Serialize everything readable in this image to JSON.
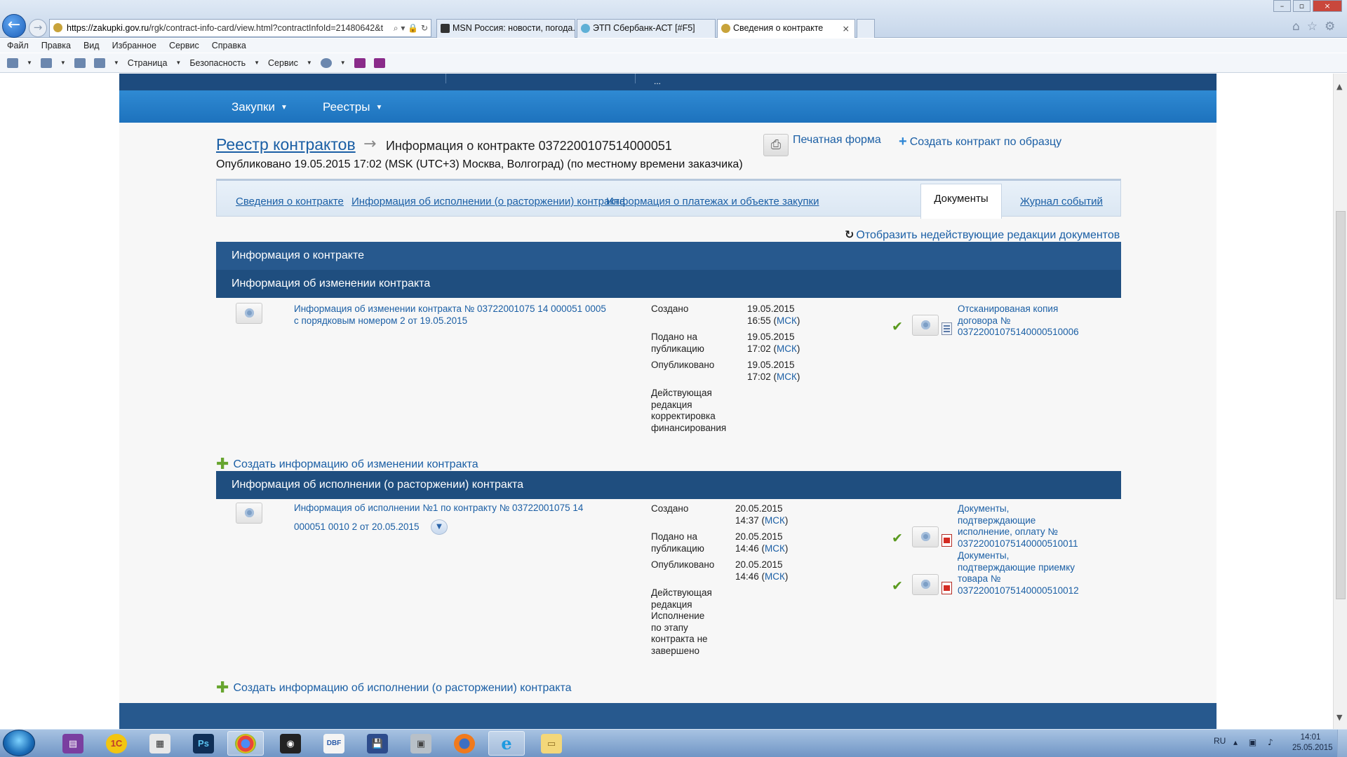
{
  "browser": {
    "url_site": "https://zakupki.gov.ru",
    "url_rest": "/rgk/contract-info-card/view.html?contractInfoId=21480642&t",
    "tabs": [
      {
        "label": "MSN Россия: новости, погода..."
      },
      {
        "label": "ЭТП Сбербанк-АСТ [#F5]"
      },
      {
        "label": "Сведения о контракте",
        "active": true
      }
    ],
    "menu": [
      "Файл",
      "Правка",
      "Вид",
      "Избранное",
      "Сервис",
      "Справка"
    ],
    "commands": {
      "page": "Страница",
      "security": "Безопасность",
      "service": "Сервис"
    }
  },
  "site": {
    "topnav_more": "...",
    "nav": [
      "Закупки",
      "Реестры"
    ],
    "breadcrumb": {
      "root": "Реестр контрактов",
      "current": "Информация о контракте 0372200107514000051"
    },
    "print_form": "Печатная форма",
    "create_by_sample": "Создать контракт по образцу",
    "published": "Опубликовано 19.05.2015 17:02 (MSK (UTC+3) Москва, Волгоград) (по местному времени заказчика)",
    "tabs": [
      "Сведения о контракте",
      "Информация об исполнении (о расторжении) контракта",
      "Информация о платежах и объекте закупки",
      "Документы",
      "Журнал событий"
    ],
    "active_tab": "Документы",
    "show_inactive": "Отобразить недействующие редакции документов"
  },
  "sections": {
    "contract_info": "Информация о контракте",
    "change_info": {
      "title": "Информация об изменении контракта",
      "doc_title_1": "Информация об изменении контракта № 03722001075 14 000051 0005",
      "doc_title_2": "с порядковым номером 2 от 19.05.2015",
      "created_label": "Создано",
      "created_date": "19.05.2015",
      "created_time": "16:55",
      "submitted_label_1": "Подано на",
      "submitted_label_2": "публикацию",
      "submitted_date": "19.05.2015",
      "submitted_time": "17:02",
      "published_label": "Опубликовано",
      "published_date": "19.05.2015",
      "published_time": "17:02",
      "tz": "МСК",
      "status_lines": [
        "Действующая",
        "редакция",
        "корректировка",
        "финансирования"
      ],
      "file_lines": [
        "Отсканированая копия",
        "договора №",
        "03722001075140000510006"
      ],
      "add_link": "Создать информацию об изменении контракта"
    },
    "execution_info": {
      "title": "Информация об исполнении (о расторжении) контракта",
      "doc_title_1": "Информация об исполнении №1 по контракту № 03722001075 14",
      "doc_title_2": "000051 0010 2 от 20.05.2015",
      "created_label": "Создано",
      "created_date": "20.05.2015",
      "created_time": "14:37",
      "submitted_label_1": "Подано на",
      "submitted_label_2": "публикацию",
      "submitted_date": "20.05.2015",
      "submitted_time": "14:46",
      "published_label": "Опубликовано",
      "published_date": "20.05.2015",
      "published_time": "14:46",
      "tz": "МСК",
      "status_lines": [
        "Действующая",
        "редакция",
        "Исполнение",
        "по этапу",
        "контракта не",
        "завершено"
      ],
      "file1_lines": [
        "Документы,",
        "подтверждающие",
        "исполнение, оплату №",
        "03722001075140000510011"
      ],
      "file2_lines": [
        "Документы,",
        "подтверждающие приемку",
        "товара №",
        "03722001075140000510012"
      ],
      "add_link": "Создать информацию об исполнении (о расторжении) контракта"
    }
  },
  "taskbar": {
    "apps": [
      "1c",
      "Ps",
      "chrome",
      "camera",
      "DBF",
      "save",
      "boxes",
      "firefox",
      "ie",
      "explorer"
    ],
    "lang": "RU",
    "time": "14:01",
    "date": "25.05.2015"
  },
  "colors": {
    "header_blue": "#1d72bd",
    "section_blue": "#27598e",
    "link": "#1b5fa5"
  }
}
